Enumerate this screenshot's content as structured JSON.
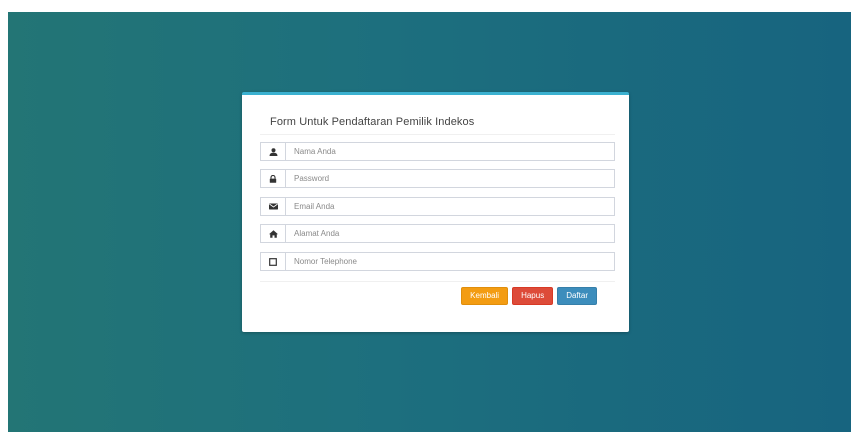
{
  "colors": {
    "background_start": "#237575",
    "background_end": "#17647f",
    "card_accent": "#3bb1d0",
    "btn_kembali": "#f39c12",
    "btn_hapus": "#dd4b39",
    "btn_daftar": "#3c8dbc"
  },
  "form": {
    "title": "Form Untuk Pendaftaran Pemilik Indekos",
    "fields": [
      {
        "icon": "user-icon",
        "placeholder": "Nama Anda",
        "value": ""
      },
      {
        "icon": "lock-icon",
        "placeholder": "Password",
        "value": ""
      },
      {
        "icon": "envelope-icon",
        "placeholder": "Email Anda",
        "value": ""
      },
      {
        "icon": "home-icon",
        "placeholder": "Alamat Anda",
        "value": ""
      },
      {
        "icon": "phone-icon",
        "placeholder": "Nomor Telephone",
        "value": ""
      }
    ],
    "buttons": {
      "kembali": "Kembali",
      "hapus": "Hapus",
      "daftar": "Daftar"
    }
  }
}
